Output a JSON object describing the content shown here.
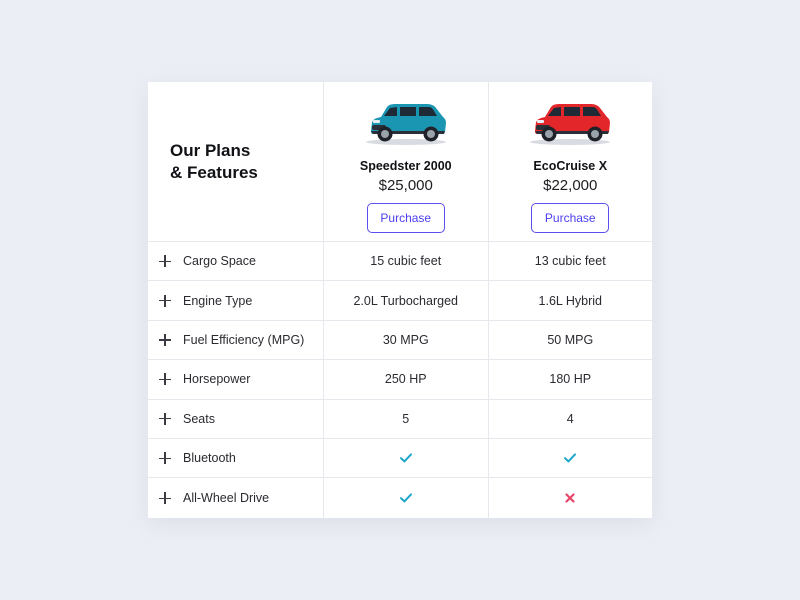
{
  "header": {
    "title": "Our Plans\n& Features"
  },
  "plans": [
    {
      "name": "Speedster 2000",
      "price": "$25,000",
      "button_label": "Purchase",
      "car_color": "#1a95b2",
      "car_icon": "suv-car-icon"
    },
    {
      "name": "EcoCruise X",
      "price": "$22,000",
      "button_label": "Purchase",
      "car_color": "#e2262a",
      "car_icon": "suv-car-icon"
    }
  ],
  "features": [
    {
      "label": "Cargo Space",
      "a": "15 cubic feet",
      "b": "13 cubic feet"
    },
    {
      "label": "Engine Type",
      "a": "2.0L Turbocharged",
      "b": "1.6L Hybrid"
    },
    {
      "label": "Fuel Efficiency (MPG)",
      "a": "30 MPG",
      "b": "50 MPG"
    },
    {
      "label": "Horsepower",
      "a": "250 HP",
      "b": "180 HP"
    },
    {
      "label": "Seats",
      "a": "5",
      "b": "4"
    },
    {
      "label": "Bluetooth",
      "a_icon": "check-icon",
      "b_icon": "check-icon"
    },
    {
      "label": "All-Wheel Drive",
      "a_icon": "check-icon",
      "b_icon": "cross-icon"
    }
  ],
  "colors": {
    "background": "#eceef5",
    "accent": "#4a3ff0",
    "check": "#1aa7c9",
    "cross": "#e8476a"
  }
}
